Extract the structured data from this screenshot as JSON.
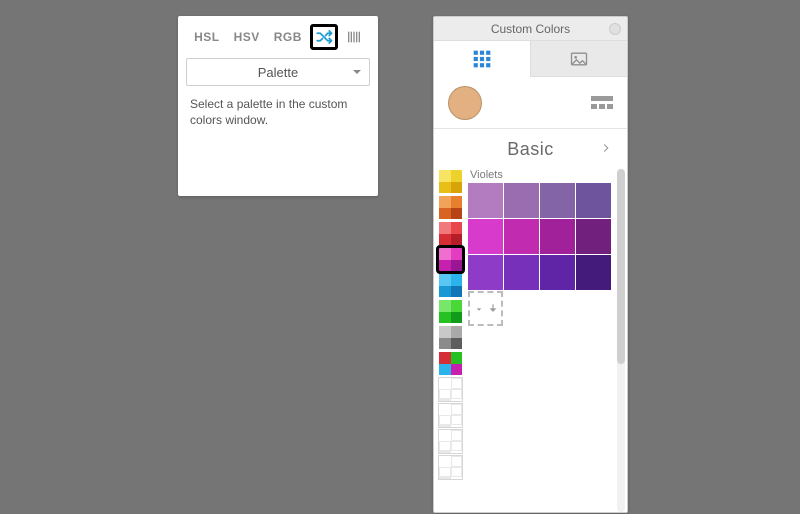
{
  "left_panel": {
    "tabs": {
      "hsl": "HSL",
      "hsv": "HSV",
      "rgb": "RGB"
    },
    "selected_tab": "shuffle",
    "select_label": "Palette",
    "help_text": "Select a palette in the custom colors window."
  },
  "right_panel": {
    "title": "Custom Colors",
    "group_name": "Basic",
    "current_color": "#e2b081",
    "section_label": "Violets",
    "violets": [
      "#b37cc0",
      "#9a6db0",
      "#8264a7",
      "#6d549c",
      "#d83acb",
      "#c02bb0",
      "#a02199",
      "#71207e",
      "#8e3cc7",
      "#7730ba",
      "#5f25a6",
      "#441a7a"
    ],
    "thumbnails": [
      {
        "colors": [
          "#f7e463",
          "#edd22c",
          "#e8bf17",
          "#d8a40a"
        ]
      },
      {
        "colors": [
          "#f2a35a",
          "#e87f2c",
          "#d96322",
          "#b64417"
        ]
      },
      {
        "colors": [
          "#f1797c",
          "#e8474c",
          "#d62e36",
          "#b41e28"
        ]
      },
      {
        "colors": [
          "#ef6ecf",
          "#e33cc1",
          "#c71fae",
          "#9a1793"
        ],
        "highlighted": true
      },
      {
        "colors": [
          "#58c7f3",
          "#2bb4ec",
          "#1a98d6",
          "#0f77b8"
        ]
      },
      {
        "colors": [
          "#78e66a",
          "#49d837",
          "#26c223",
          "#109c19"
        ]
      },
      {
        "colors": [
          "#c9c9c9",
          "#a9a9a9",
          "#8b8b8b",
          "#5d5d5d"
        ]
      },
      {
        "colors": [
          "#d62e36",
          "#26c223",
          "#2bb4ec",
          "#c71fae"
        ]
      },
      {
        "empty": true
      },
      {
        "empty": true
      },
      {
        "empty": true
      },
      {
        "empty": true
      }
    ]
  }
}
